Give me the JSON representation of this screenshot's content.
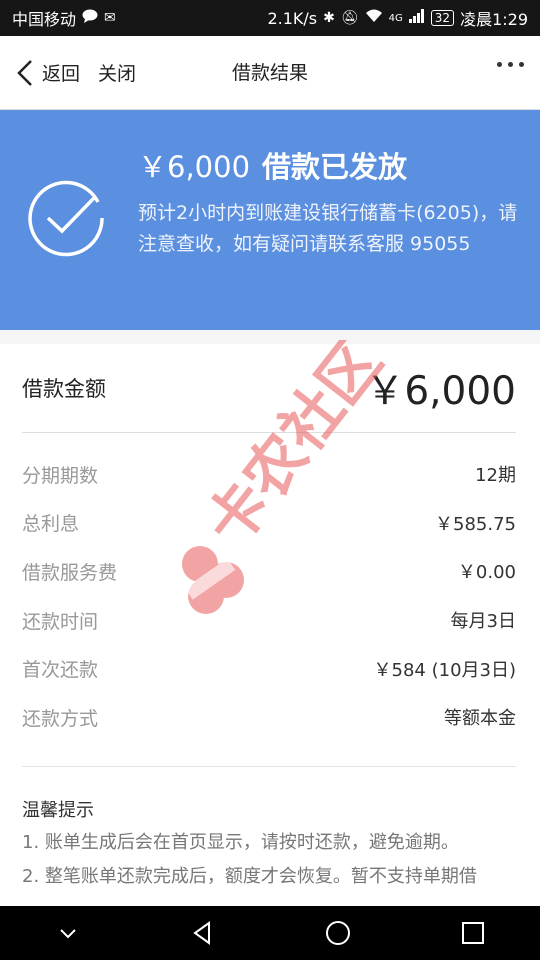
{
  "statusbar": {
    "carrier": "中国移动",
    "speed": "2.1K/s",
    "network": "4G",
    "battery": "32",
    "time": "凌晨1:29"
  },
  "navbar": {
    "back_label": "返回",
    "close_label": "关闭",
    "title": "借款结果"
  },
  "banner": {
    "amount": "￥6,000",
    "status": "借款已发放",
    "description": "预计2小时内到账建设银行储蓄卡(6205)，请注意查收，如有疑问请联系客服 95055"
  },
  "loan": {
    "amount_label": "借款金额",
    "amount_value": "￥6,000",
    "details": [
      {
        "label": "分期期数",
        "value": "12期"
      },
      {
        "label": "总利息",
        "value": "￥585.75"
      },
      {
        "label": "借款服务费",
        "value": "￥0.00"
      },
      {
        "label": "还款时间",
        "value": "每月3日"
      },
      {
        "label": "首次还款",
        "value": "￥584 (10月3日)"
      },
      {
        "label": "还款方式",
        "value": "等额本金"
      }
    ]
  },
  "tips": {
    "title": "温馨提示",
    "items": [
      "1. 账单生成后会在首页显示，请按时还款，避免逾期。",
      "2. 整笔账单还款完成后，额度才会恢复。暂不支持单期借"
    ]
  },
  "watermark": {
    "text": "卡农社区"
  },
  "colors": {
    "banner": "#5b8fe0",
    "watermark": "#e85a5a"
  }
}
